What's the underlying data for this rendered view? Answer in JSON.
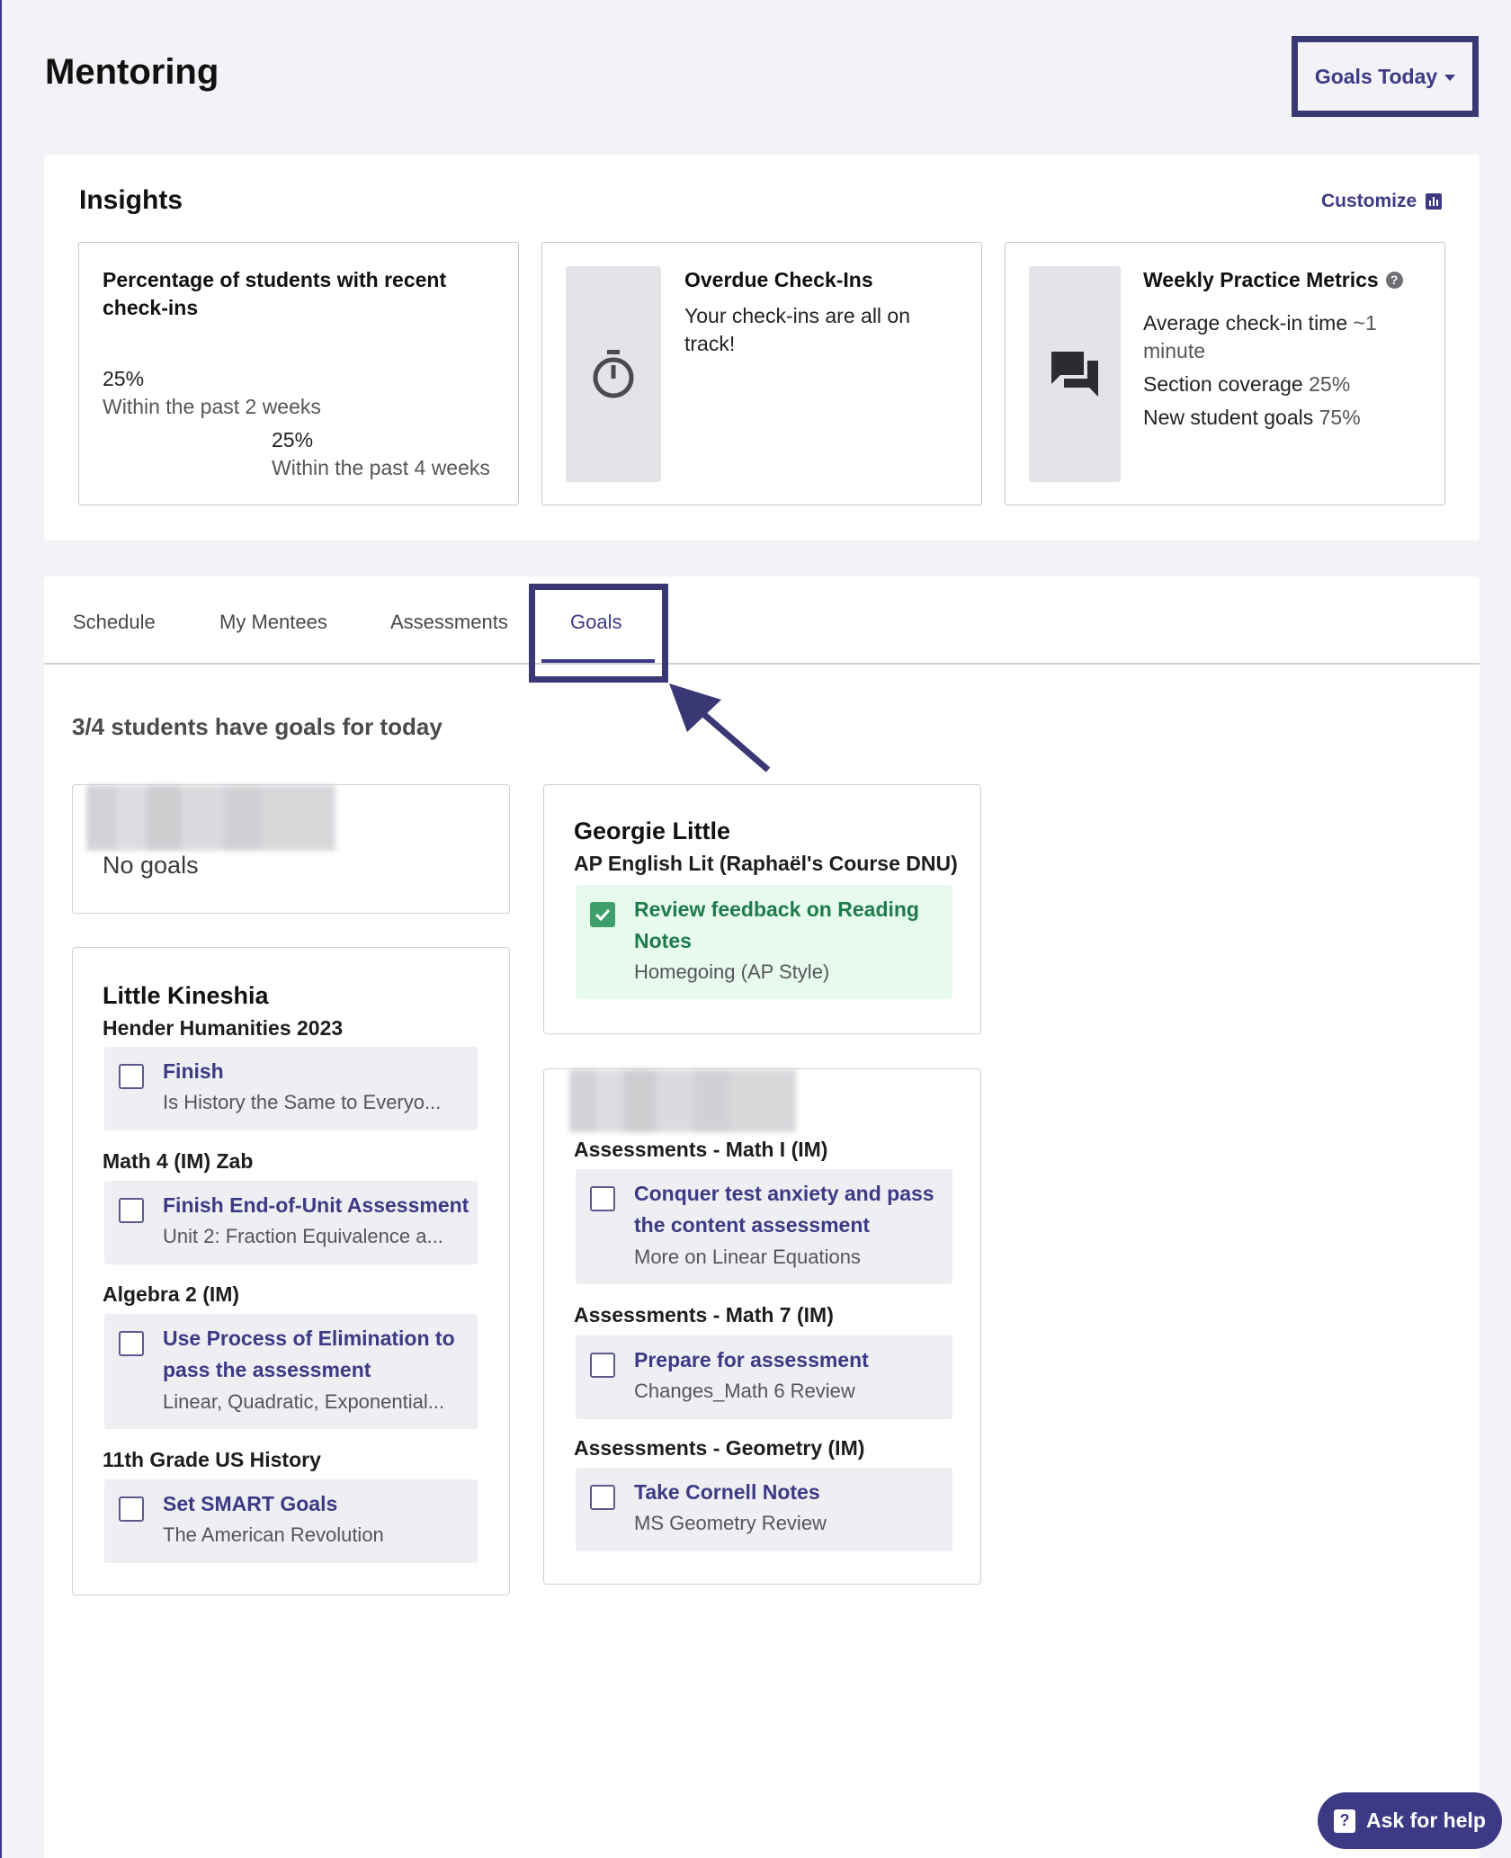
{
  "header": {
    "title": "Mentoring",
    "goals_today_label": "Goals Today"
  },
  "insights": {
    "title": "Insights",
    "customize_label": "Customize",
    "recent_checkins": {
      "title": "Percentage of students with recent check-ins",
      "two_week_value": "25%",
      "two_week_label": "Within the past 2 weeks",
      "four_week_value": "25%",
      "four_week_label": "Within the past 4 weeks"
    },
    "overdue": {
      "title": "Overdue Check-Ins",
      "text": "Your check-ins are all on track!",
      "icon": "stopwatch-icon"
    },
    "weekly": {
      "title": "Weekly Practice Metrics",
      "icon": "chat-icon",
      "avg_label": "Average check-in time",
      "avg_value": "~1 minute",
      "section_label": "Section coverage",
      "section_value": "25%",
      "new_goals_label": "New student goals",
      "new_goals_value": "75%"
    }
  },
  "tabs": [
    "Schedule",
    "My Mentees",
    "Assessments",
    "Goals"
  ],
  "goals": {
    "summary": "3/4 students have goals for today",
    "no_goals_label": "No goals",
    "kineshia": {
      "name": "Little Kineshia",
      "courses": [
        {
          "name": "Hender Humanities 2023",
          "goal": "Finish",
          "sub": "Is History the Same to Everyo..."
        },
        {
          "name": "Math 4 (IM) Zab",
          "goal": "Finish End-of-Unit Assessment",
          "sub": "Unit 2: Fraction Equivalence a..."
        },
        {
          "name": "Algebra 2 (IM)",
          "goal": "Use Process of Elimination to pass the assessment",
          "sub": "Linear, Quadratic, Exponential..."
        },
        {
          "name": "11th Grade US History",
          "goal": "Set SMART Goals",
          "sub": "The American Revolution"
        }
      ]
    },
    "georgie": {
      "name": "Georgie Little",
      "course": "AP English Lit (Raphaël's Course DNU)",
      "goal": "Review feedback on Reading Notes",
      "sub": "Homegoing (AP Style)"
    },
    "hidden_student": {
      "courses": [
        {
          "name": "Assessments - Math I (IM)",
          "goal": "Conquer test anxiety and pass the content assessment",
          "sub": "More on Linear Equations"
        },
        {
          "name": "Assessments - Math 7 (IM)",
          "goal": "Prepare for assessment",
          "sub": "Changes_Math 6 Review"
        },
        {
          "name": "Assessments - Geometry (IM)",
          "goal": "Take Cornell Notes",
          "sub": "MS Geometry Review"
        }
      ]
    }
  },
  "help": {
    "label": "Ask for help"
  },
  "colors": {
    "accent": "#3d3a85",
    "success": "#1f7b4a",
    "success_bg": "#e6fbee"
  }
}
